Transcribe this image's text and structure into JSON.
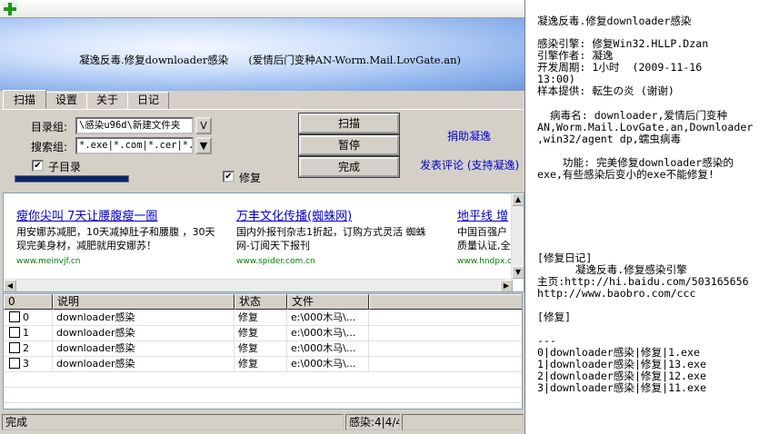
{
  "banner": {
    "title": "凝逸反毒.修复downloader感染",
    "subtitle": "(爱情后门变种AN-Worm.Mail.LovGate.an)"
  },
  "tabs": [
    {
      "label": "扫描"
    },
    {
      "label": "设置"
    },
    {
      "label": "关于"
    },
    {
      "label": "日记"
    }
  ],
  "scan": {
    "dir_label": "目录组:",
    "dir_value": "\\感染u96d\\新建文件夹",
    "dir_button": "V",
    "search_label": "搜索组:",
    "search_value": "*.exe|*.com|*.cer|*.c:",
    "subdir_label": "子目录",
    "subdir_checked": true,
    "repair_label": "修复",
    "repair_checked": true,
    "btn_scan": "扫描",
    "btn_pause": "暂停",
    "btn_done": "完成",
    "link_donate": "捐助凝逸",
    "link_comment": "发表评论 (支持凝逸)",
    "progress": 1.0
  },
  "ads": [
    {
      "title": "瘦你尖叫 7天让腰腹瘦一圈",
      "desc1": "用安娜苏减肥，10天减掉肚子和腰腹 ，30天",
      "desc2": "现完美身材，减肥就用安娜苏！",
      "url": "www.meinvjf.cn"
    },
    {
      "title": "万丰文化传播(蜘蛛网)",
      "desc1": "国内外报刊杂志1折起，订购方式灵活 蜘蛛",
      "desc2": "网-订阅天下报刊",
      "url": "www.spider.com.cn"
    },
    {
      "title": "地平线 增",
      "desc1": "中国百强户",
      "desc2": "质量认证,全",
      "url": "www.hndpx.c"
    }
  ],
  "table": {
    "columns": [
      "0",
      "说明",
      "状态",
      "文件"
    ],
    "rows": [
      {
        "id": "0",
        "desc": "downloader感染",
        "status": "修复",
        "file": "e:\\000木马\\..."
      },
      {
        "id": "1",
        "desc": "downloader感染",
        "status": "修复",
        "file": "e:\\000木马\\..."
      },
      {
        "id": "2",
        "desc": "downloader感染",
        "status": "修复",
        "file": "e:\\000木马\\..."
      },
      {
        "id": "3",
        "desc": "downloader感染",
        "status": "修复",
        "file": "e:\\000木马\\..."
      }
    ]
  },
  "status": {
    "left": "完成",
    "middle": "感染:4|4/4"
  },
  "notes": {
    "l1": "凝逸反毒.修复downloader感染",
    "l2": "感染引擎: 修复Win32.HLLP.Dzan",
    "l3": "引擎作者: 凝逸",
    "l4": "开发周期: 1小时  (2009-11-16",
    "l5": "13:00)",
    "l6": "样本提供: 転生の炎 (谢谢)",
    "l7": "  病毒名: downloader,爱情后门变种",
    "l8": "AN,Worm.Mail.LovGate.an,Downloader",
    "l9": ",win32/agent dp,蠕虫病毒",
    "l10": "    功能: 完美修复downloader感染的",
    "l11": "exe,有些感染后变小的exe不能修复!",
    "l12": "[修复日记]",
    "l13": "      凝逸反毒.修复感染引擎",
    "l14": "主页:http://hi.baidu.com/503165656",
    "l15": "http://www.baobro.com/ccc",
    "l16": "[修复]",
    "l17": "---",
    "l18": "0|downloader感染|修复|1.exe",
    "l19": "1|downloader感染|修复|13.exe",
    "l20": "2|downloader感染|修复|12.exe",
    "l21": "3|downloader感染|修复|11.exe"
  },
  "colors": {
    "window_bg": "#d4d0c8",
    "link": "#0000cc",
    "progress": "#0a246a",
    "ad_url": "#008000"
  }
}
